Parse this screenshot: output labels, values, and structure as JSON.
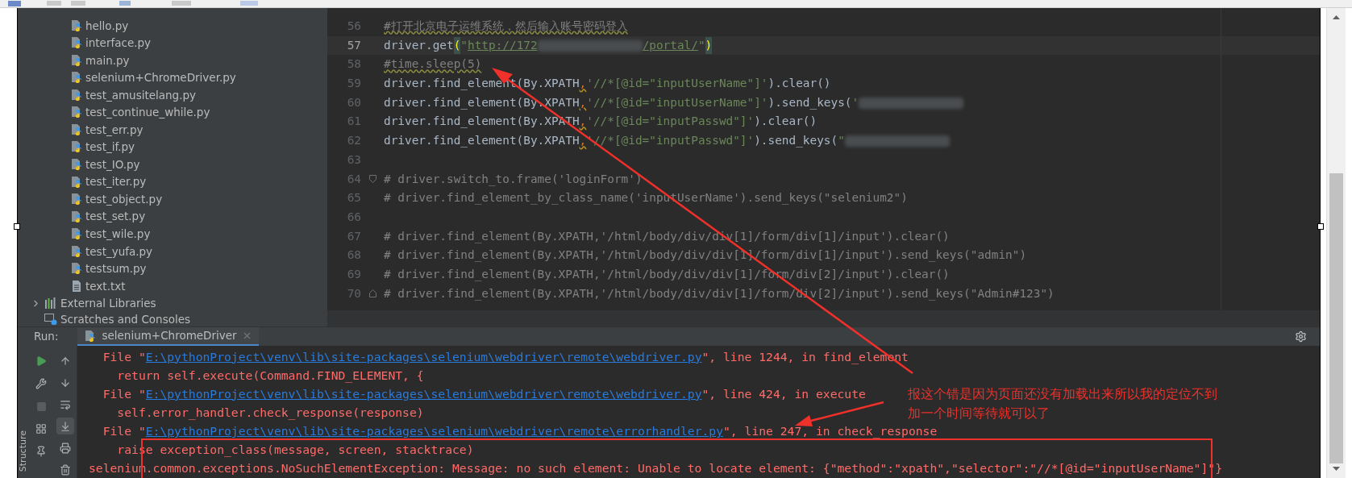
{
  "project_tree": {
    "items": [
      {
        "name": "hello.py",
        "kind": "python"
      },
      {
        "name": "interface.py",
        "kind": "python"
      },
      {
        "name": "main.py",
        "kind": "python"
      },
      {
        "name": "selenium+ChromeDriver.py",
        "kind": "python"
      },
      {
        "name": "test_amusitelang.py",
        "kind": "python"
      },
      {
        "name": "test_continue_while.py",
        "kind": "python"
      },
      {
        "name": "test_err.py",
        "kind": "python"
      },
      {
        "name": "test_if.py",
        "kind": "python"
      },
      {
        "name": "test_IO.py",
        "kind": "python"
      },
      {
        "name": "test_iter.py",
        "kind": "python"
      },
      {
        "name": "test_object.py",
        "kind": "python"
      },
      {
        "name": "test_set.py",
        "kind": "python"
      },
      {
        "name": "test_wile.py",
        "kind": "python"
      },
      {
        "name": "test_yufa.py",
        "kind": "python"
      },
      {
        "name": "testsum.py",
        "kind": "python"
      },
      {
        "name": "text.txt",
        "kind": "text"
      }
    ],
    "external_libraries": {
      "label": "External Libraries",
      "expanded": false
    },
    "scratches": {
      "label": "Scratches and Consoles"
    }
  },
  "editor": {
    "lines": [
      {
        "number": "56",
        "current": false,
        "segments": [
          {
            "text": "#打开北京电子运维系统，然后输入账号密码登入",
            "kind": "comment-typo"
          }
        ]
      },
      {
        "number": "57",
        "current": true,
        "segments": [
          {
            "text": "driver.get",
            "kind": "code"
          },
          {
            "text": "(",
            "kind": "brace"
          },
          {
            "text": "\"",
            "kind": "string"
          },
          {
            "text": "http://172",
            "kind": "url"
          },
          {
            "kind": "redacted"
          },
          {
            "text": "/portal/",
            "kind": "url"
          },
          {
            "text": "\"",
            "kind": "string"
          },
          {
            "text": ")",
            "kind": "brace"
          }
        ]
      },
      {
        "number": "58",
        "current": false,
        "segments": [
          {
            "text": "#time.sleep(5)",
            "kind": "comment-typo"
          }
        ]
      },
      {
        "number": "59",
        "current": false,
        "segments": [
          {
            "text": "driver.find_element(By.XPATH",
            "kind": "code"
          },
          {
            "text": ",",
            "kind": "warn"
          },
          {
            "text": "'//*[@id=\"inputUserName\"]'",
            "kind": "string"
          },
          {
            "text": ").clear()",
            "kind": "code"
          }
        ]
      },
      {
        "number": "60",
        "current": false,
        "segments": [
          {
            "text": "driver.find_element(By.XPATH",
            "kind": "code"
          },
          {
            "text": ",",
            "kind": "warn"
          },
          {
            "text": "'//*[@id=\"inputUserName\"]'",
            "kind": "string"
          },
          {
            "text": ").send_keys(",
            "kind": "code"
          },
          {
            "text": "'",
            "kind": "string"
          },
          {
            "kind": "redacted"
          }
        ]
      },
      {
        "number": "61",
        "current": false,
        "segments": [
          {
            "text": "driver.find_element(By.XPATH",
            "kind": "code"
          },
          {
            "text": ",",
            "kind": "warn"
          },
          {
            "text": "'//*[@id=\"inputPasswd\"]'",
            "kind": "string"
          },
          {
            "text": ").clear()",
            "kind": "code"
          }
        ]
      },
      {
        "number": "62",
        "current": false,
        "segments": [
          {
            "text": "driver.find_element(By.XPATH",
            "kind": "code"
          },
          {
            "text": ",",
            "kind": "warn"
          },
          {
            "text": "'//*[@id=\"inputPasswd\"]'",
            "kind": "string"
          },
          {
            "text": ").send_keys(",
            "kind": "code"
          },
          {
            "text": "\"",
            "kind": "string"
          },
          {
            "kind": "redacted"
          }
        ]
      },
      {
        "number": "63",
        "current": false
      },
      {
        "number": "64",
        "current": false,
        "fold_start": true,
        "segments": [
          {
            "text": "# driver.switch_to.frame('loginForm')",
            "kind": "comment"
          }
        ]
      },
      {
        "number": "65",
        "current": false,
        "segments": [
          {
            "text": "# driver.find_element_by_class_name('inputUserName').send_keys(\"selenium2\")",
            "kind": "comment"
          }
        ]
      },
      {
        "number": "66",
        "current": false
      },
      {
        "number": "67",
        "current": false,
        "segments": [
          {
            "text": "# driver.find_element(By.XPATH,'/html/body/div/div[1]/form/div[1]/input').clear()",
            "kind": "comment"
          }
        ]
      },
      {
        "number": "68",
        "current": false,
        "segments": [
          {
            "text": "# driver.find_element(By.XPATH,'/html/body/div/div[1]/form/div[1]/input').send_keys(\"admin\")",
            "kind": "comment"
          }
        ]
      },
      {
        "number": "69",
        "current": false,
        "segments": [
          {
            "text": "# driver.find_element(By.XPATH,'/html/body/div/div[1]/form/div[2]/input').clear()",
            "kind": "comment"
          }
        ]
      },
      {
        "number": "70",
        "current": false,
        "fold_end": true,
        "segments": [
          {
            "text": "# driver.find_element(By.XPATH,'/html/body/div/div[1]/form/div[2]/input').send_keys(\"Admin#123\")",
            "kind": "comment"
          }
        ]
      }
    ]
  },
  "run_panel": {
    "label": "Run:",
    "tab": {
      "label": "selenium+ChromeDriver",
      "selected": true
    },
    "side_label": "Structure",
    "console": [
      {
        "segments": [
          {
            "text": "  File \"",
            "kind": "error"
          },
          {
            "text": "E:\\pythonProject\\venv\\lib\\site-packages\\selenium\\webdriver\\remote\\webdriver.py",
            "kind": "link"
          },
          {
            "text": "\", line 1244, in find_element",
            "kind": "error"
          }
        ]
      },
      {
        "segments": [
          {
            "text": "    return self.execute(Command.FIND_ELEMENT, {",
            "kind": "error"
          }
        ]
      },
      {
        "segments": [
          {
            "text": "  File \"",
            "kind": "error"
          },
          {
            "text": "E:\\pythonProject\\venv\\lib\\site-packages\\selenium\\webdriver\\remote\\webdriver.py",
            "kind": "link"
          },
          {
            "text": "\", line 424, in execute",
            "kind": "error"
          }
        ]
      },
      {
        "segments": [
          {
            "text": "    self.error_handler.check_response(response)",
            "kind": "error"
          }
        ]
      },
      {
        "segments": [
          {
            "text": "  File \"",
            "kind": "error"
          },
          {
            "text": "E:\\pythonProject\\venv\\lib\\site-packages\\selenium\\webdriver\\remote\\errorhandler.py",
            "kind": "link"
          },
          {
            "text": "\", line 247, in check_response",
            "kind": "error"
          }
        ]
      },
      {
        "segments": [
          {
            "text": "    raise exception_class(message, screen, stacktrace)",
            "kind": "error"
          }
        ]
      },
      {
        "segments": [
          {
            "text": "selenium.common.exceptions.NoSuchElementException: Message: no such element: Unable to locate element: {\"method\":\"xpath\",\"selector\":\"//*[@id=\"inputUserName\"]\"}",
            "kind": "error"
          }
        ]
      }
    ]
  },
  "annotation": {
    "lines": [
      "报这个错是因为页面还没有加载出来所以我的定位不到",
      "加一个时间等待就可以了"
    ]
  }
}
